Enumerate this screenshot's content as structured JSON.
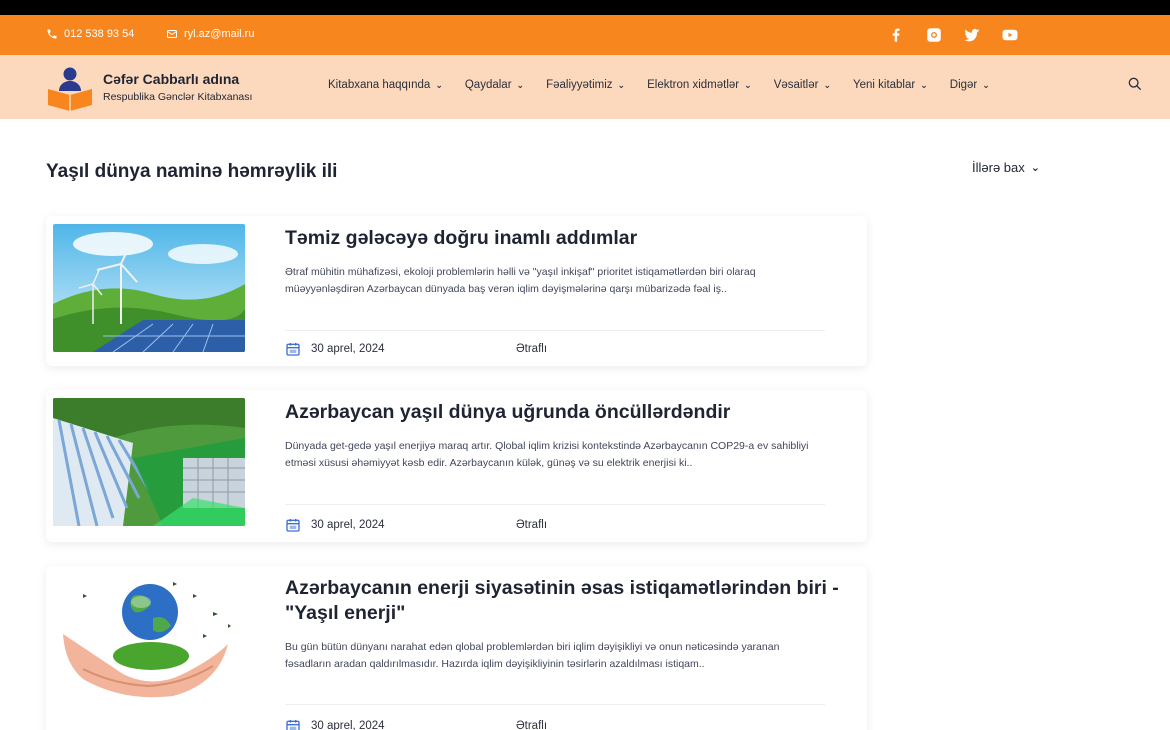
{
  "topbar": {
    "phone": "012 538 93 54",
    "email": "ryl.az@mail.ru",
    "social": [
      "facebook-icon",
      "instagram-icon",
      "twitter-icon",
      "youtube-icon"
    ]
  },
  "brand": {
    "name": "Cəfər Cabbarlı adına",
    "subtitle": "Respublika Gənclər Kitabxanası"
  },
  "nav": {
    "items": [
      "Kitabxana haqqında",
      "Qaydalar",
      "Fəaliyyətimiz",
      "Elektron xidmətlər",
      "Vəsaitlər",
      "Yeni kitablar",
      "Digər"
    ]
  },
  "page": {
    "title": "Yaşıl dünya naminə həmrəylik ili",
    "years_filter": "İllərə bax"
  },
  "articles": [
    {
      "title": "Təmiz gələcəyə doğru inamlı addımlar",
      "excerpt": "Ətraf mühitin mühafizəsi, ekoloji problemlərin həlli və \"yaşıl inkişaf\" prioritet istiqamətlərdən biri olaraq müəyyənləşdirən Azərbaycan dünyada baş verən iqlim dəyişmələrinə qarşı mübarizədə fəal iş..",
      "date": "30 aprel, 2024",
      "more": "Ətraflı"
    },
    {
      "title": "Azərbaycan yaşıl dünya uğrunda öncüllərdəndir",
      "excerpt": "Dünyada get-gedə yaşıl enerjiyə maraq artır. Qlobal iqlim krizisi kontekstində Azərbaycanın COP29-a ev sahibliyi etməsi xüsusi əhəmiyyət kəsb edir. Azərbaycanın külək, günəş və su elektrik enerjisi ki..",
      "date": "30 aprel, 2024",
      "more": "Ətraflı"
    },
    {
      "title": "Azərbaycanın enerji siyasətinin əsas istiqamətlərindən biri - \"Yaşıl enerji\"",
      "excerpt": "Bu gün bütün dünyanı narahat edən qlobal problemlərdən biri iqlim dəyişikliyi və onun nəticəsində yaranan fəsadların aradan qaldırılmasıdır. Hazırda iqlim dəyişikliyinin təsirlərin azaldılması istiqam..",
      "date": "30 aprel, 2024",
      "more": "Ətraflı"
    }
  ],
  "colors": {
    "topbar": "#f7861f",
    "navbar": "#fcd9bd",
    "accent": "#3d6fd8"
  }
}
